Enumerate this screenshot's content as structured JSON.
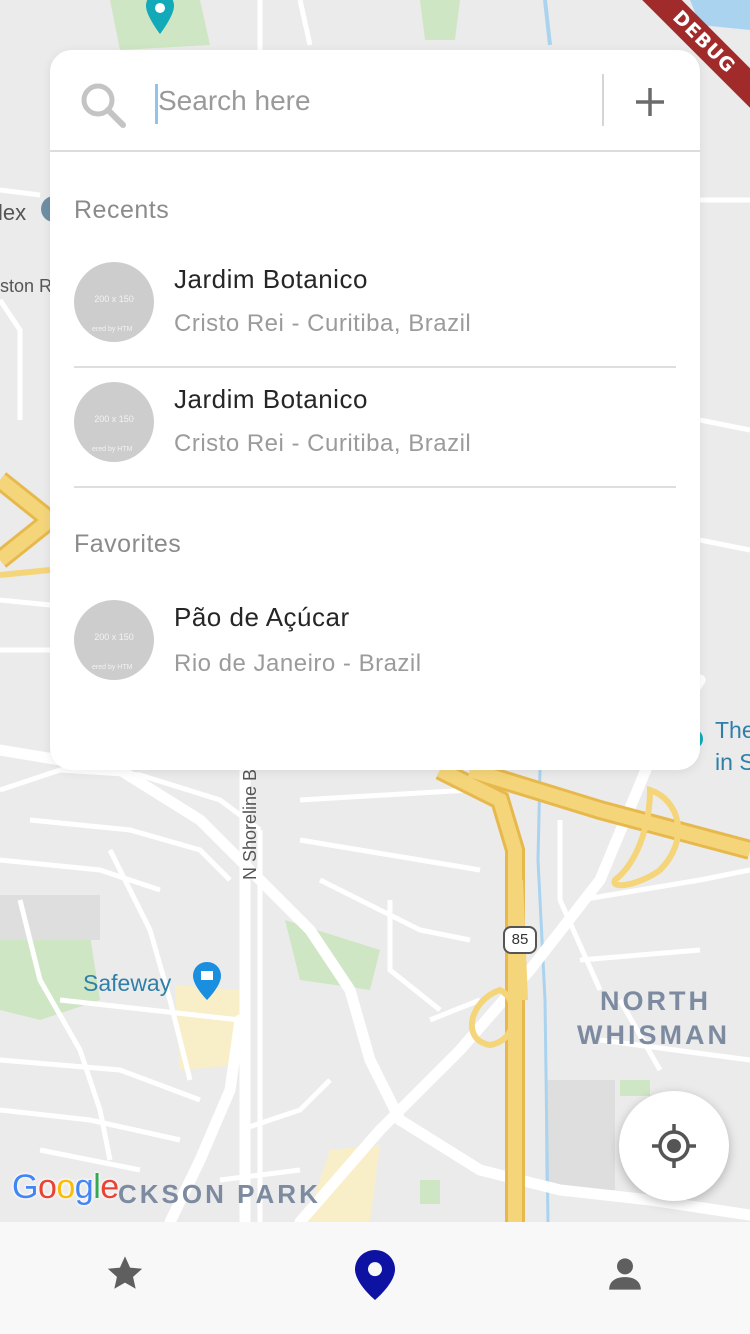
{
  "map": {
    "poi_labels": [
      "Safeway",
      "The",
      "in S",
      "lex",
      "ston R"
    ],
    "area_labels": [
      "NORTH",
      "WHISMAN",
      "CKSON PARK"
    ],
    "street_labels": [
      "N Shoreline B"
    ],
    "highway_shield": "85",
    "google_logo": [
      "G",
      "o",
      "o",
      "g",
      "l",
      "e"
    ],
    "google_colors": [
      "#4285F4",
      "#EA4335",
      "#FBBC05",
      "#4285F4",
      "#34A853",
      "#EA4335"
    ]
  },
  "debug_banner": "DEBUG",
  "search": {
    "placeholder": "Search here",
    "value": ""
  },
  "recents": {
    "title": "Recents",
    "items": [
      {
        "name": "Jardim Botanico",
        "subtitle": "Cristo Rei - Curitiba, Brazil",
        "thumb_text": "200 x 150",
        "thumb_credit": "ered by HTM"
      },
      {
        "name": "Jardim Botanico",
        "subtitle": "Cristo Rei - Curitiba, Brazil",
        "thumb_text": "200 x 150",
        "thumb_credit": "ered by HTM"
      }
    ]
  },
  "favorites": {
    "title": "Favorites",
    "items": [
      {
        "name": "Pão de Açúcar",
        "subtitle": "Rio de Janeiro - Brazil",
        "thumb_text": "200 x 150",
        "thumb_credit": "ered by HTM"
      }
    ]
  },
  "bottom_nav": {
    "items": [
      {
        "icon": "star-icon",
        "active": false
      },
      {
        "icon": "map-pin-icon",
        "active": true
      },
      {
        "icon": "person-icon",
        "active": false
      }
    ],
    "active_color": "#0d12a3",
    "inactive_color": "#5f5f5f"
  },
  "colors": {
    "highway": "#f5d57a",
    "highway_edge": "#e7b94c",
    "road": "#ffffff",
    "park": "#cfe6c4",
    "water": "#aad3f0"
  }
}
